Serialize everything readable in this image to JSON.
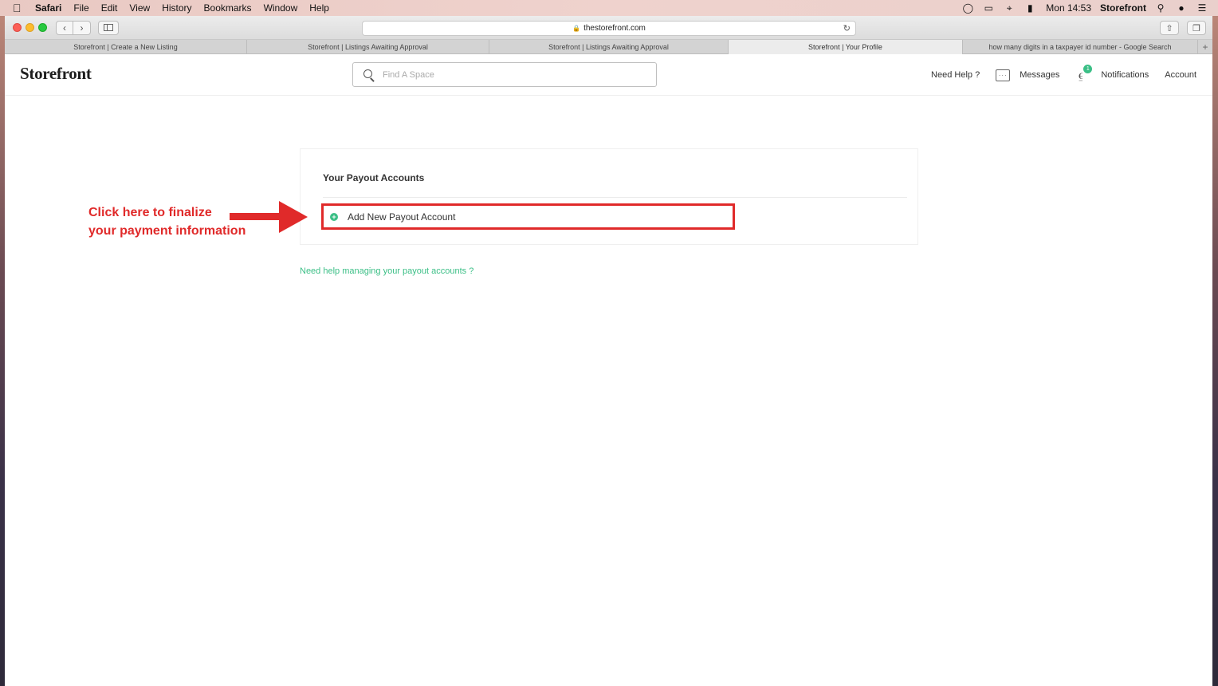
{
  "menubar": {
    "app": "Safari",
    "items": [
      "File",
      "Edit",
      "View",
      "History",
      "Bookmarks",
      "Window",
      "Help"
    ],
    "clock": "Mon 14:53",
    "user": "Storefront"
  },
  "browser": {
    "url": "thestorefront.com",
    "tabs": [
      {
        "title": "Storefront | Create a New Listing",
        "active": false
      },
      {
        "title": "Storefront | Listings Awaiting Approval",
        "active": false
      },
      {
        "title": "Storefront | Listings Awaiting Approval",
        "active": false
      },
      {
        "title": "Storefront | Your Profile",
        "active": true
      },
      {
        "title": "how many digits in a taxpayer id number - Google Search",
        "active": false
      }
    ],
    "new_tab_glyph": "+"
  },
  "header": {
    "logo": "Storefront",
    "search_placeholder": "Find A Space",
    "need_help": "Need Help ?",
    "messages": "Messages",
    "notifications": "Notifications",
    "notifications_count": "1",
    "account": "Account"
  },
  "payout": {
    "title": "Your Payout Accounts",
    "add_label": "Add New Payout Account",
    "help_link": "Need help managing your payout accounts ?"
  },
  "annotation": {
    "line1": "Click here to finalize",
    "line2": "your payment information"
  },
  "colors": {
    "accent_green": "#3bbf86",
    "annotation_red": "#e02a2a"
  }
}
